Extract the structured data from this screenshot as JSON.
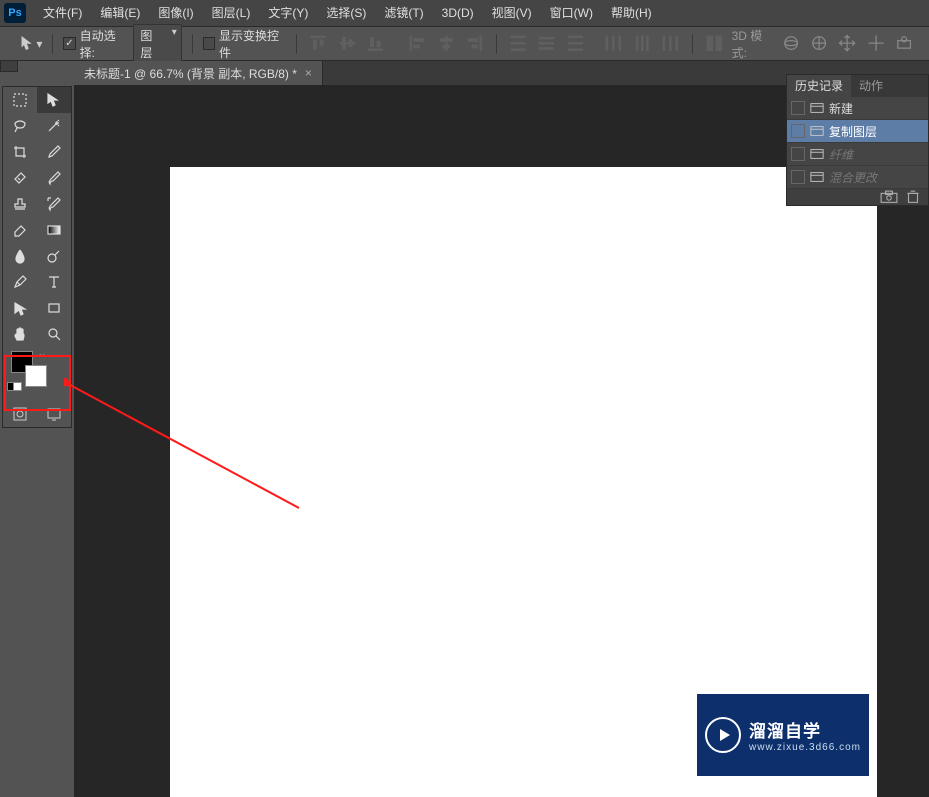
{
  "menu": {
    "items": [
      "文件(F)",
      "编辑(E)",
      "图像(I)",
      "图层(L)",
      "文字(Y)",
      "选择(S)",
      "滤镜(T)",
      "3D(D)",
      "视图(V)",
      "窗口(W)",
      "帮助(H)"
    ]
  },
  "options": {
    "auto_select_label": "自动选择:",
    "auto_select_checked": true,
    "select_value": "图层",
    "show_transform_label": "显示变换控件",
    "show_transform_checked": false,
    "mode3d_label": "3D 模式:"
  },
  "document": {
    "tab_title": "未标题-1 @ 66.7% (背景 副本, RGB/8) *"
  },
  "tools": [
    {
      "name": "marquee-tool",
      "icon": "rect-dash"
    },
    {
      "name": "move-tool",
      "icon": "move",
      "selected": true
    },
    {
      "name": "lasso-tool",
      "icon": "lasso"
    },
    {
      "name": "magic-wand-tool",
      "icon": "wand"
    },
    {
      "name": "crop-tool",
      "icon": "crop"
    },
    {
      "name": "eyedropper-tool",
      "icon": "eyedrop"
    },
    {
      "name": "healing-brush-tool",
      "icon": "bandage"
    },
    {
      "name": "brush-tool",
      "icon": "brush"
    },
    {
      "name": "clone-stamp-tool",
      "icon": "stamp"
    },
    {
      "name": "history-brush-tool",
      "icon": "histbrush"
    },
    {
      "name": "eraser-tool",
      "icon": "eraser"
    },
    {
      "name": "gradient-tool",
      "icon": "gradient"
    },
    {
      "name": "blur-tool",
      "icon": "drop"
    },
    {
      "name": "dodge-tool",
      "icon": "dodge"
    },
    {
      "name": "pen-tool",
      "icon": "pen"
    },
    {
      "name": "type-tool",
      "icon": "type"
    },
    {
      "name": "path-select-tool",
      "icon": "arrow"
    },
    {
      "name": "rectangle-tool",
      "icon": "rect"
    },
    {
      "name": "hand-tool",
      "icon": "hand"
    },
    {
      "name": "zoom-tool",
      "icon": "zoom"
    }
  ],
  "colors": {
    "foreground": "#000000",
    "background": "#ffffff"
  },
  "history": {
    "tab_history": "历史记录",
    "tab_actions": "动作",
    "items": [
      {
        "label": "新建",
        "selected": false,
        "dim": false
      },
      {
        "label": "复制图层",
        "selected": true,
        "dim": false
      },
      {
        "label": "纤维",
        "selected": false,
        "dim": true
      },
      {
        "label": "混合更改",
        "selected": false,
        "dim": true
      }
    ]
  },
  "watermark": {
    "title": "溜溜自学",
    "url": "www.zixue.3d66.com"
  }
}
